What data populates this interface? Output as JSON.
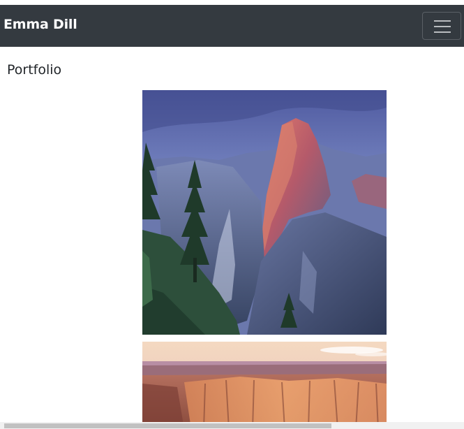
{
  "navbar": {
    "brand": "Emma Dill",
    "toggler_icon": "hamburger-menu-icon"
  },
  "page": {
    "heading": "Portfolio"
  },
  "gallery": {
    "items": [
      {
        "subject": "mountain-dome-sunset-photo"
      },
      {
        "subject": "canyon-cliffs-sunset-photo"
      }
    ]
  },
  "colors": {
    "navbar_bg": "#343a40",
    "brand_text": "#ffffff",
    "heading_text": "#212529"
  }
}
